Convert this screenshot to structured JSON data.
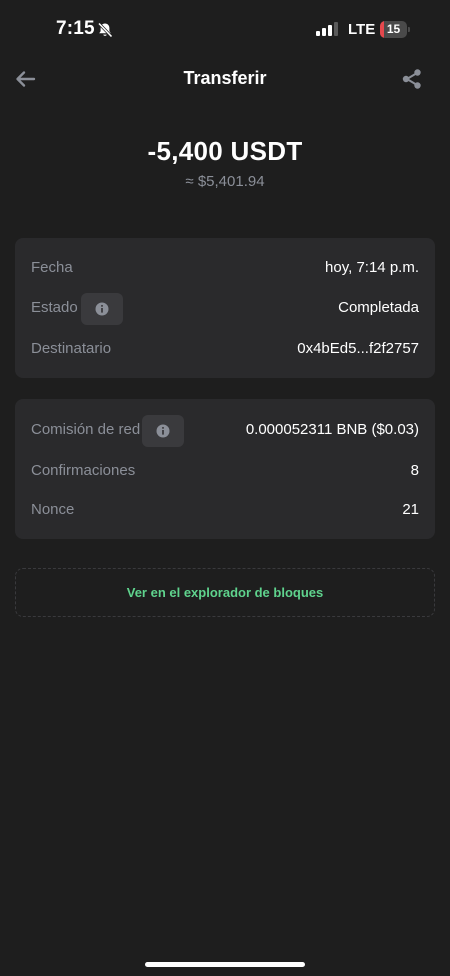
{
  "status_bar": {
    "time": "7:15",
    "network": "LTE",
    "battery_level": "15",
    "battery_fraction": 0.15,
    "signal_bars": 3,
    "icons": [
      "bell-off-icon",
      "signal-icon",
      "battery-icon"
    ]
  },
  "header": {
    "title": "Transferir",
    "back_icon": "arrow-left-icon",
    "share_icon": "share-icon"
  },
  "amount": {
    "value": "-5,400 USDT",
    "fiat": "≈ $5,401.94"
  },
  "details": {
    "date_label": "Fecha",
    "date_value": "hoy, 7:14 p.m.",
    "status_label": "Estado",
    "status_value": "Completada",
    "recipient_label": "Destinatario",
    "recipient_value": "0x4bEd5...f2f2757"
  },
  "network": {
    "fee_label": "Comisión de red",
    "fee_value": "0.000052311 BNB ($0.03)",
    "confirmations_label": "Confirmaciones",
    "confirmations_value": "8",
    "nonce_label": "Nonce",
    "nonce_value": "21"
  },
  "explorer": {
    "label": "Ver en el explorador de bloques"
  },
  "colors": {
    "background": "#1e1e1e",
    "card": "#2a2a2c",
    "accent_green": "#5fd38d",
    "muted_text": "#8b8f98",
    "battery_low": "#e5484d"
  }
}
